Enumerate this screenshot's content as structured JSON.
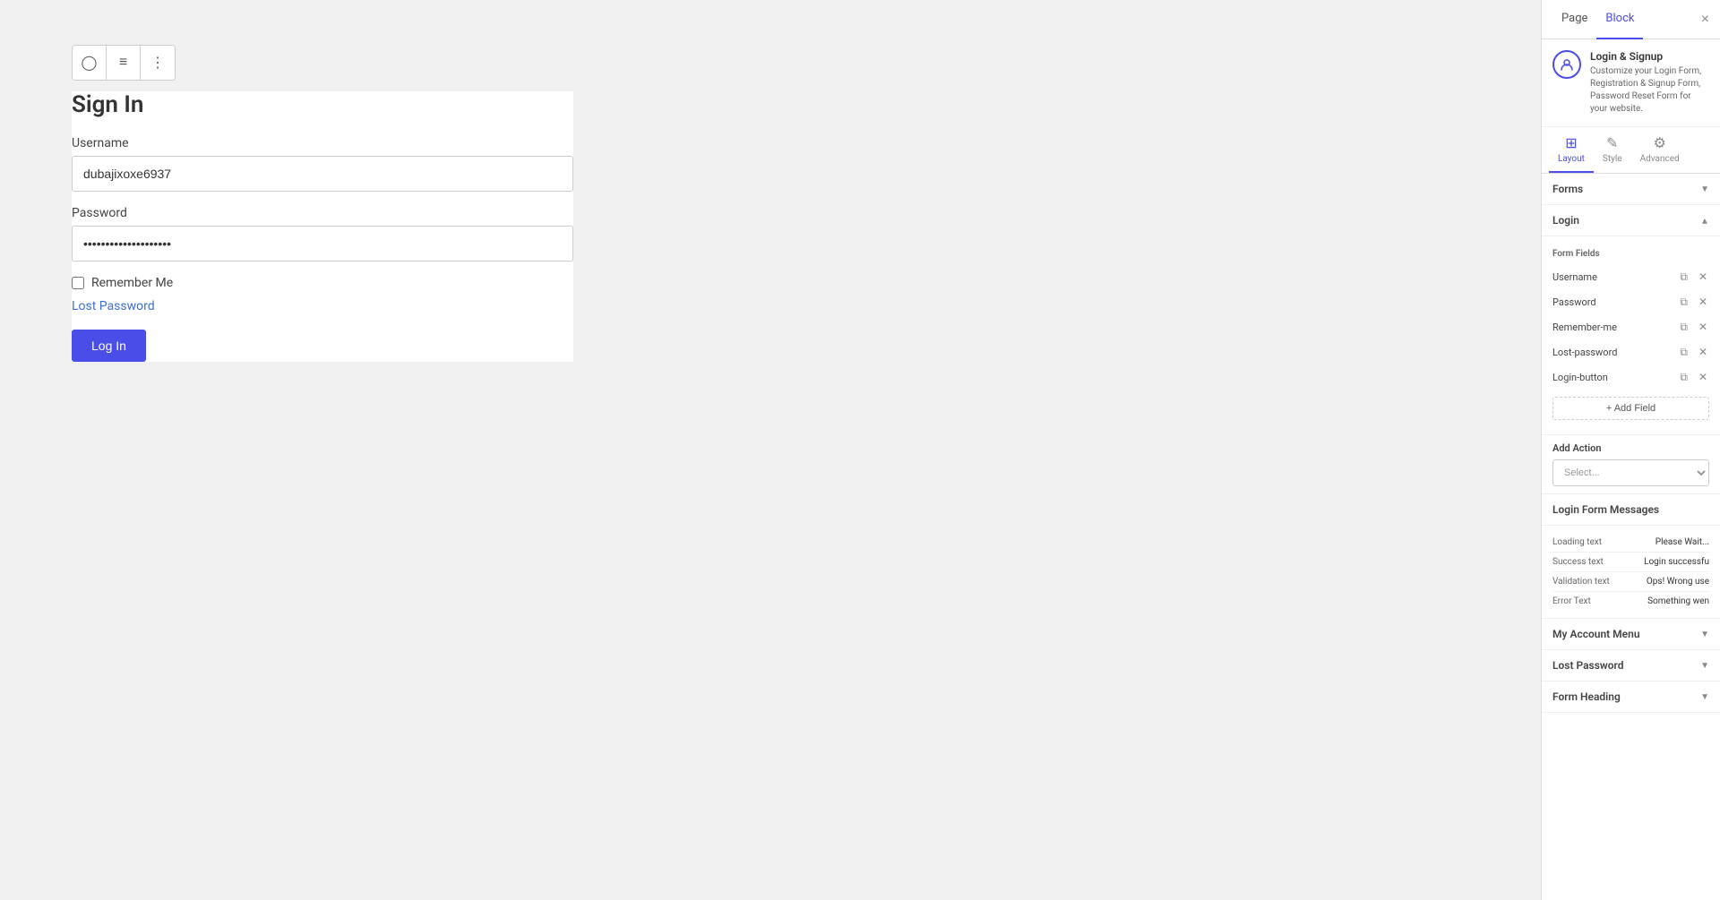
{
  "panel": {
    "tabs": [
      {
        "id": "page",
        "label": "Page",
        "active": false
      },
      {
        "id": "block",
        "label": "Block",
        "active": true
      }
    ],
    "close_label": "×",
    "plugin": {
      "name": "Login & Signup",
      "description": "Customize your Login Form, Registration & Signup Form, Password Reset Form for your website."
    },
    "sub_tabs": [
      {
        "id": "layout",
        "label": "Layout",
        "icon": "⊞",
        "active": true
      },
      {
        "id": "style",
        "label": "Style",
        "icon": "✎",
        "active": false
      },
      {
        "id": "advanced",
        "label": "Advanced",
        "icon": "⚙",
        "active": false
      }
    ],
    "forms_section": {
      "label": "Forms",
      "collapsed": false
    },
    "login_section": {
      "label": "Login",
      "expanded": true,
      "form_fields_label": "Form Fields",
      "fields": [
        {
          "name": "Username"
        },
        {
          "name": "Password"
        },
        {
          "name": "Remember-me"
        },
        {
          "name": "Lost-password"
        },
        {
          "name": "Login-button"
        }
      ],
      "add_field_label": "+ Add Field"
    },
    "add_action": {
      "label": "Add Action",
      "select_placeholder": "Select..."
    },
    "messages": {
      "section_label": "Login Form Messages",
      "items": [
        {
          "key": "Loading text",
          "value": "Please Wait..."
        },
        {
          "key": "Success text",
          "value": "Login successfu"
        },
        {
          "key": "Validation text",
          "value": "Ops! Wrong use"
        },
        {
          "key": "Error Text",
          "value": "Something wen"
        }
      ]
    },
    "my_account_menu": {
      "label": "My Account Menu",
      "collapsed": true
    },
    "lost_password": {
      "label": "Lost Password",
      "collapsed": true
    },
    "form_heading": {
      "label": "Form Heading",
      "collapsed": true
    }
  },
  "form": {
    "title": "Sign In",
    "username_label": "Username",
    "username_value": "dubajixoxe6937",
    "password_label": "Password",
    "password_value": "••••••••••••••••••••",
    "remember_me_label": "Remember Me",
    "lost_password_label": "Lost Password",
    "login_button_label": "Log In"
  },
  "toolbar": {
    "user_icon": "⊙",
    "list_icon": "≡",
    "dots_icon": "⋮"
  }
}
